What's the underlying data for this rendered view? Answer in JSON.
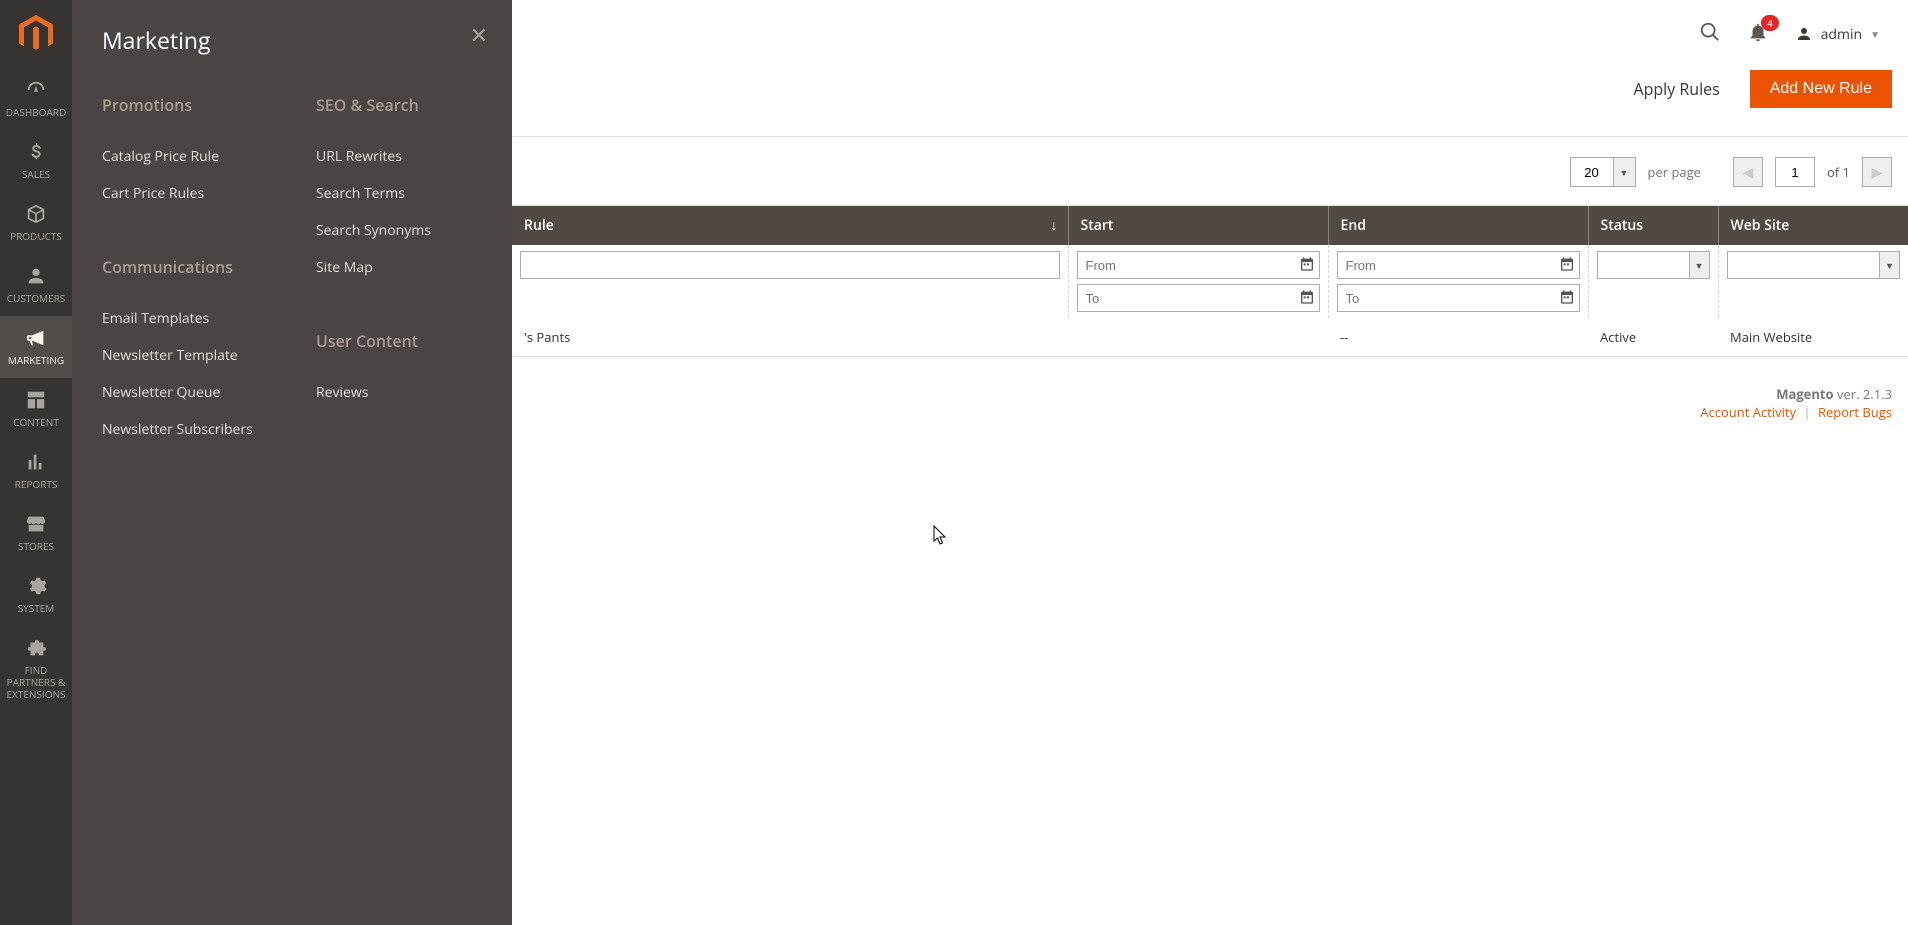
{
  "sidebar": {
    "items": [
      {
        "label": "DASHBOARD"
      },
      {
        "label": "SALES"
      },
      {
        "label": "PRODUCTS"
      },
      {
        "label": "CUSTOMERS"
      },
      {
        "label": "MARKETING"
      },
      {
        "label": "CONTENT"
      },
      {
        "label": "REPORTS"
      },
      {
        "label": "STORES"
      },
      {
        "label": "SYSTEM"
      },
      {
        "label": "FIND PARTNERS & EXTENSIONS"
      }
    ]
  },
  "flyout": {
    "title": "Marketing",
    "groups": {
      "promotions": {
        "title": "Promotions",
        "items": [
          "Catalog Price Rule",
          "Cart Price Rules"
        ]
      },
      "communications": {
        "title": "Communications",
        "items": [
          "Email Templates",
          "Newsletter Template",
          "Newsletter Queue",
          "Newsletter Subscribers"
        ]
      },
      "seo": {
        "title": "SEO & Search",
        "items": [
          "URL Rewrites",
          "Search Terms",
          "Search Synonyms",
          "Site Map"
        ]
      },
      "ugc": {
        "title": "User Content",
        "items": [
          "Reviews"
        ]
      }
    }
  },
  "header": {
    "notification_count": "4",
    "admin_label": "admin"
  },
  "actions": {
    "apply": "Apply Rules",
    "add": "Add New Rule"
  },
  "pager": {
    "per_page_value": "20",
    "per_page_label": "per page",
    "page": "1",
    "of_label": "of 1"
  },
  "table": {
    "cols": {
      "rule": "Rule",
      "start": "Start",
      "end": "End",
      "status": "Status",
      "site": "Web Site"
    },
    "filter": {
      "from_placeholder": "From",
      "to_placeholder": "To"
    },
    "rows": [
      {
        "rule": "'s Pants",
        "start": "",
        "end": "--",
        "status": "Active",
        "site": "Main Website"
      }
    ]
  },
  "footer": {
    "brand": "Magento",
    "ver": " ver. 2.1.3",
    "activity": "Account Activity",
    "bugs": "Report Bugs"
  }
}
